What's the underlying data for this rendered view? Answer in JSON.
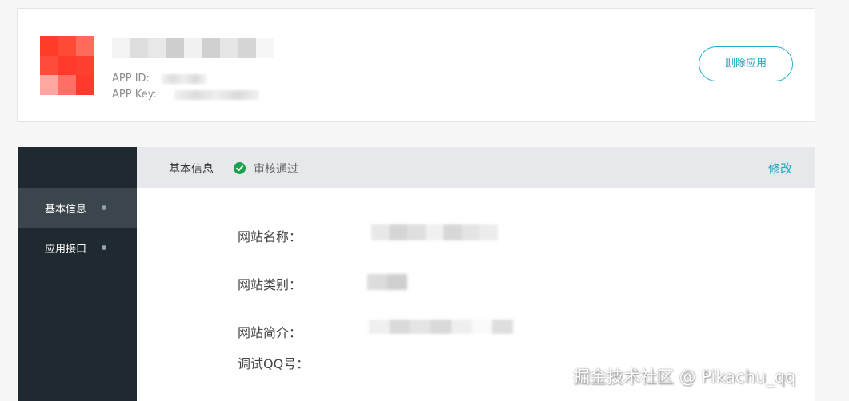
{
  "app_card": {
    "app_id_label": "APP ID:",
    "app_key_label": "APP Key:",
    "delete_button": "删除应用"
  },
  "sidebar": {
    "items": [
      {
        "label": "基本信息",
        "active": true
      },
      {
        "label": "应用接口",
        "active": false
      }
    ]
  },
  "panel": {
    "title": "基本信息",
    "status": "审核通过",
    "edit_link": "修改",
    "fields": [
      {
        "label": "网站名称："
      },
      {
        "label": "网站类别："
      },
      {
        "label": "网站简介："
      },
      {
        "label": "调试QQ号："
      }
    ]
  },
  "watermark": "掘金技术社区 @ Pikachu_qq",
  "colors": {
    "accent": "#1fa8c3",
    "sidebar_bg": "#1f2a30",
    "sidebar_active": "#3b454c",
    "status_green": "#19a24a",
    "logo_red": "#ff3b2a"
  },
  "icons": {
    "status": "check-circle-icon",
    "sidebar_marker": "dot-icon"
  }
}
